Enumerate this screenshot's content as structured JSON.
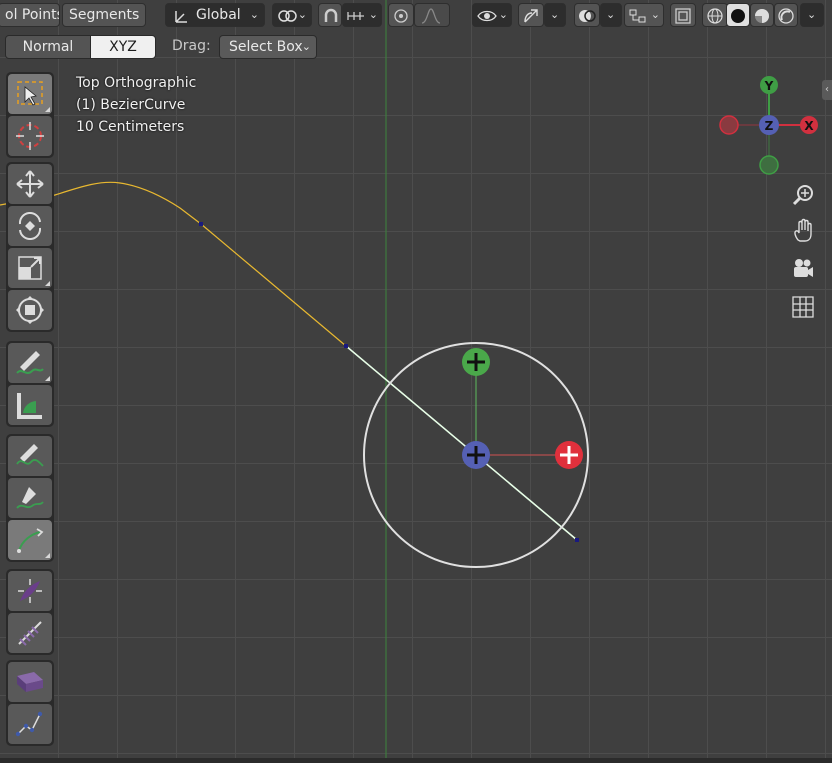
{
  "header": {
    "control_points_label": "ol Points",
    "segments_label": "Segments",
    "orientation_label": "Global",
    "icons": [
      "transform-orientation-icon",
      "pivot-point-icon",
      "snap-magnet-icon",
      "snap-increment-icon",
      "proportional-edit-icon",
      "falloff-icon",
      "visibility-icon",
      "gizmo-icon",
      "overlays-icon",
      "xray-icon",
      "wireframe-shading-icon",
      "solid-shading-icon",
      "material-shading-icon",
      "rendered-shading-icon"
    ]
  },
  "mode_row": {
    "normal_label": "Normal",
    "xyz_label": "XYZ",
    "drag_label": "Drag:",
    "drag_value": "Select Box"
  },
  "viewport_info": {
    "view_name": "Top Orthographic",
    "object_name": "(1) BezierCurve",
    "grid_scale": "10 Centimeters"
  },
  "gizmo": {
    "axis_y": "Y",
    "axis_z": "Z",
    "axis_x": "X",
    "colors": {
      "x": "#d1303f",
      "y": "#3f9e45",
      "z": "#5560b4"
    }
  },
  "toolbar": {
    "tools": [
      "select-box",
      "cursor",
      "move",
      "rotate",
      "scale",
      "transform",
      "annotate",
      "measure",
      "draw",
      "pen",
      "curve-draw",
      "radius",
      "tilt",
      "extrude",
      "randomize"
    ]
  },
  "nav": {
    "icons": [
      "zoom-icon",
      "pan-hand-icon",
      "camera-view-icon",
      "ortho-grid-icon"
    ]
  },
  "colors": {
    "curve": "#e8b830",
    "selected_segment": "#e8ffe8",
    "accent": "#4772b3"
  }
}
